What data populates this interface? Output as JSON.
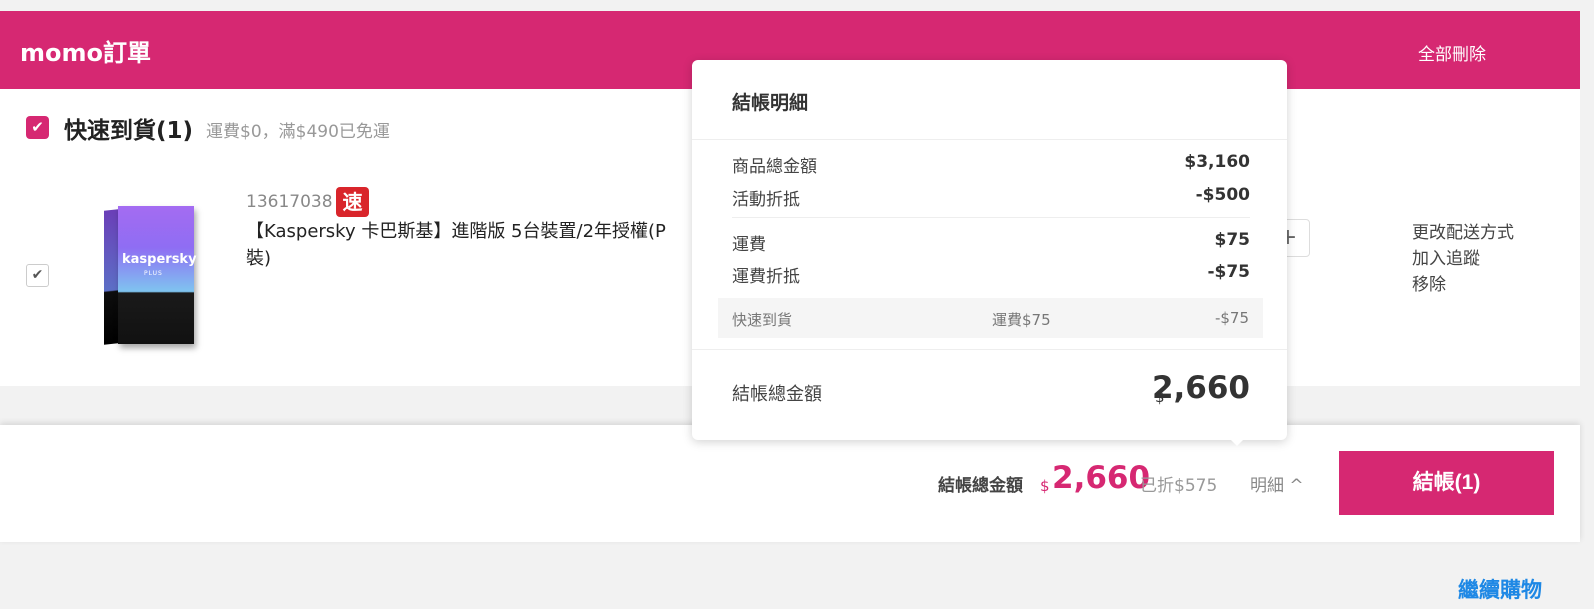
{
  "header": {
    "title": "momo訂單",
    "delete_all": "全部刪除"
  },
  "group": {
    "title": "快速到貨(1)",
    "shipping_note": "運費$0，滿$490已免運"
  },
  "item": {
    "code": "13617038",
    "badge": "速",
    "name": "【Kaspersky 卡巴斯基】進階版 5台裝置/2年授權(P\n裝)",
    "box_brand": "kaspersky",
    "box_sub": "PLUS",
    "qty_plus": "+",
    "actions": [
      "更改配送方式",
      "加入追蹤",
      "移除"
    ]
  },
  "checkout": {
    "total_label": "結帳總金額",
    "currency": "$",
    "total_value": "2,660",
    "discount_text": "已折$575",
    "detail_toggle": "明細 ^",
    "button_label": "結帳(1)"
  },
  "continue_shopping": "繼續購物",
  "popup": {
    "title": "結帳明細",
    "rows": [
      {
        "label": "商品總金額",
        "value": "$3,160"
      },
      {
        "label": "活動折抵",
        "value": "-$500"
      },
      {
        "label": "運費",
        "value": "$75"
      },
      {
        "label": "運費折抵",
        "value": "-$75"
      }
    ],
    "sub_row": {
      "name": "快速到貨",
      "fee": "運費$75",
      "discount": "-$75"
    },
    "total_label": "結帳總金額",
    "total_currency": "$",
    "total_value": "2,660"
  },
  "colors": {
    "brand": "#d62872",
    "link": "#1e88e5",
    "badge": "#d9252b"
  }
}
